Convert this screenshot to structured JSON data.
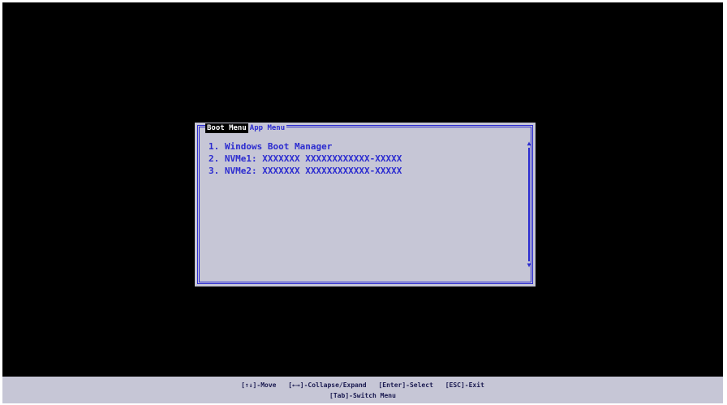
{
  "menu": {
    "tabs": [
      {
        "label": "Boot Menu",
        "active": true
      },
      {
        "label": "App Menu",
        "active": false
      }
    ],
    "items": [
      "1. Windows Boot Manager",
      "2. NVMe1: XXXXXXX XXXXXXXXXXXX-XXXXX",
      "3. NVMe2: XXXXXXX XXXXXXXXXXXX-XXXXX"
    ]
  },
  "scroll": {
    "up_icon": "arrow-up-icon",
    "down_icon": "arrow-down-icon"
  },
  "help": {
    "line1": [
      "[↑↓]-Move",
      "[←→]-Collapse/Expand",
      "[Enter]-Select",
      "[ESC]-Exit"
    ],
    "line2": "[Tab]-Switch Menu"
  },
  "colors": {
    "background": "#000000",
    "dialog": "#c6c6d6",
    "accent": "#2b2bd0"
  }
}
